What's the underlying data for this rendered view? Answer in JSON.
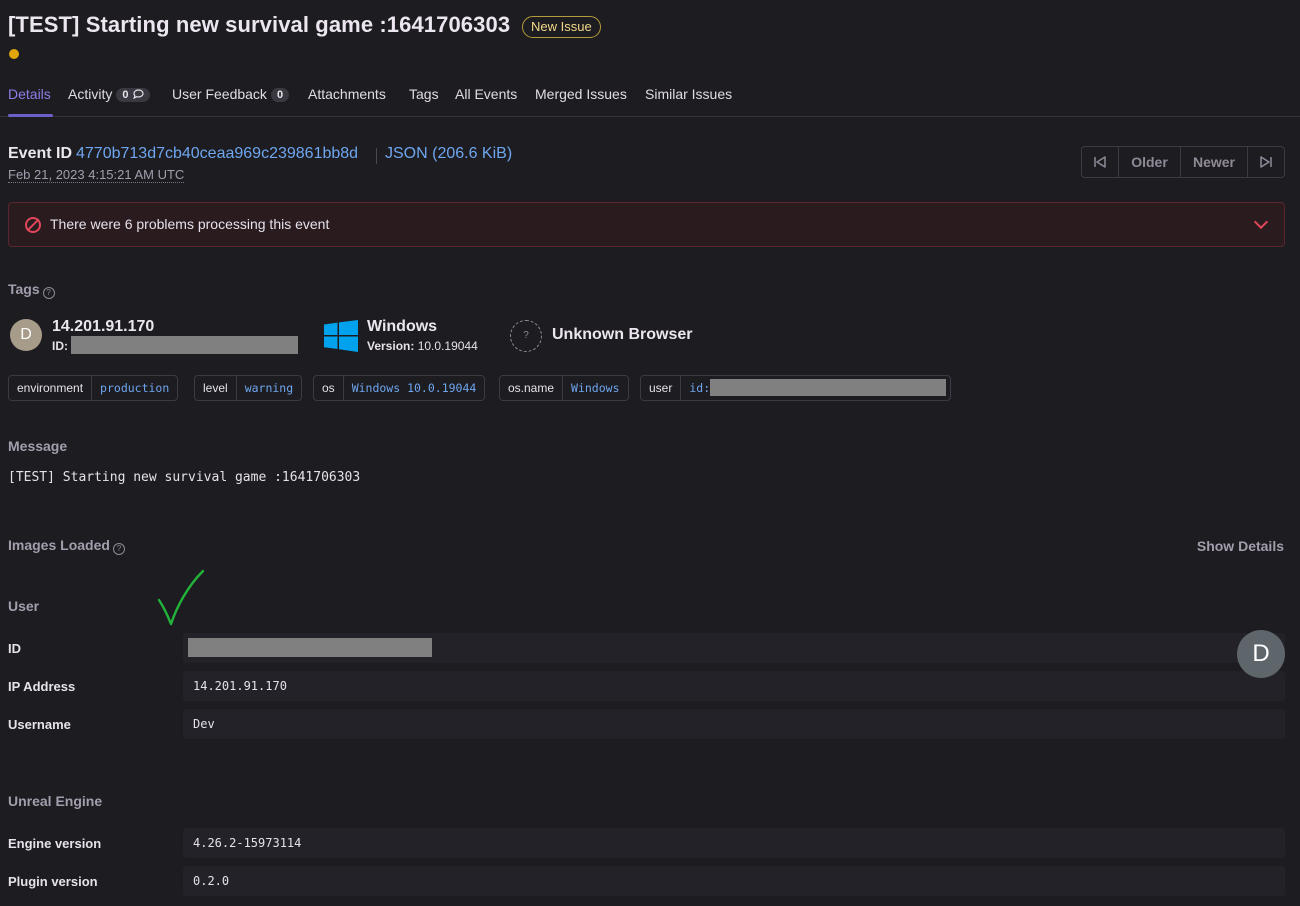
{
  "header": {
    "title": "[TEST] Starting new survival game :1641706303",
    "badge": "New Issue",
    "level_color": "#e0a60c"
  },
  "tabs": [
    {
      "label": "Details",
      "active": true
    },
    {
      "label": "Activity",
      "count": "0"
    },
    {
      "label": "User Feedback",
      "count": "0"
    },
    {
      "label": "Attachments"
    },
    {
      "label": "Tags"
    },
    {
      "label": "All Events"
    },
    {
      "label": "Merged Issues"
    },
    {
      "label": "Similar Issues"
    }
  ],
  "event": {
    "label": "Event ID",
    "id": "4770b713d7cb40ceaa969c239861bb8d",
    "json_link": "JSON (206.6 KiB)",
    "date": "Feb 21, 2023 4:15:21 AM UTC",
    "nav": {
      "older": "Older",
      "newer": "Newer"
    }
  },
  "alert": {
    "text": "There were 6 problems processing this event"
  },
  "tags_section": {
    "heading": "Tags",
    "user": {
      "avatar": "D",
      "ip": "14.201.91.170",
      "id_label": "ID:"
    },
    "os": {
      "name": "Windows",
      "version_label": "Version:",
      "version": "10.0.19044"
    },
    "browser": {
      "name": "Unknown Browser",
      "icon": "?"
    },
    "pills": [
      {
        "key": "environment",
        "value": "production"
      },
      {
        "key": "level",
        "value": "warning"
      },
      {
        "key": "os",
        "value": "Windows 10.0.19044"
      },
      {
        "key": "os.name",
        "value": "Windows"
      },
      {
        "key": "user",
        "value": "id:"
      }
    ]
  },
  "message": {
    "heading": "Message",
    "text": "[TEST] Starting new survival game :1641706303"
  },
  "images": {
    "heading": "Images Loaded",
    "action": "Show Details"
  },
  "user_ctx": {
    "heading": "User",
    "avatar": "D",
    "rows": [
      {
        "key": "ID",
        "value": ""
      },
      {
        "key": "IP Address",
        "value": "14.201.91.170"
      },
      {
        "key": "Username",
        "value": "Dev"
      }
    ]
  },
  "unreal": {
    "heading": "Unreal Engine",
    "rows": [
      {
        "key": "Engine version",
        "value": "4.26.2-15973114"
      },
      {
        "key": "Plugin version",
        "value": "0.2.0"
      }
    ]
  },
  "colors": {
    "accent": "#6c5fc7",
    "link": "#6ea6f0",
    "error": "#e0475a",
    "windows_blue": "#00a2ed",
    "checkmark": "#22b33a"
  }
}
